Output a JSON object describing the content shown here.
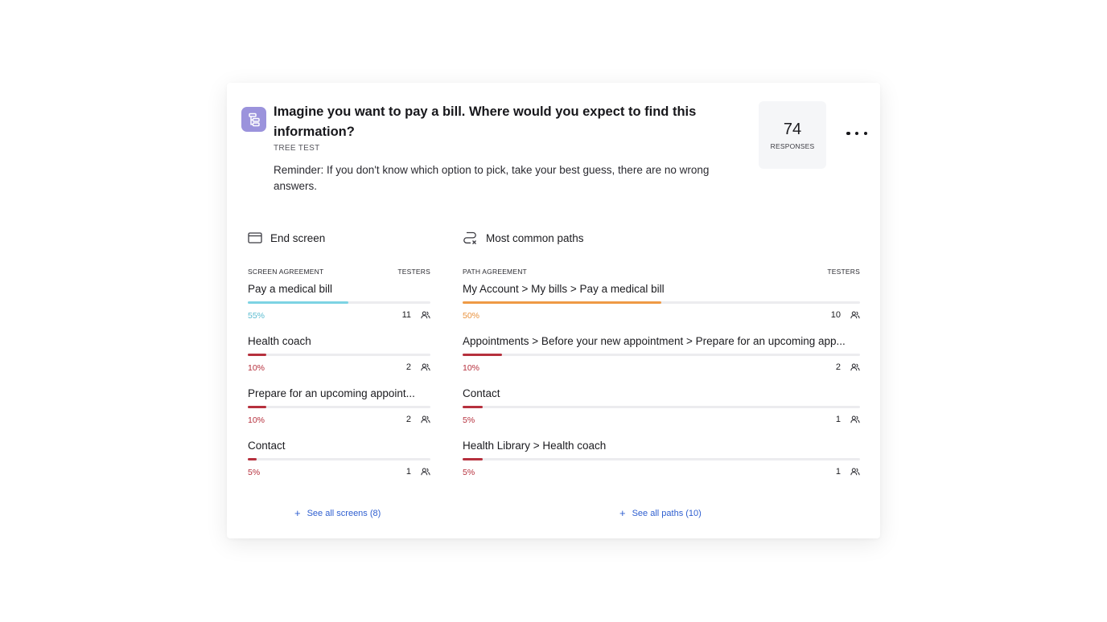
{
  "question": {
    "title": "Imagine you want to pay a bill. Where would you expect to find this information?",
    "type_label": "TREE TEST",
    "description": "Reminder: If you don't know which option to pick, take your best guess, there are no wrong answers.",
    "responses_count": "74",
    "responses_label": "RESPONSES",
    "icon": "tree-test-icon"
  },
  "end_screen": {
    "heading": "End screen",
    "col_left": "SCREEN AGREEMENT",
    "col_right": "TESTERS",
    "rows": [
      {
        "label": "Pay a medical bill",
        "percent_text": "55%",
        "fraction": 0.55,
        "count": "11",
        "color": "#7dd3e3",
        "pct_color": "#5bbcd0"
      },
      {
        "label": "Health coach",
        "percent_text": "10%",
        "fraction": 0.1,
        "count": "2",
        "color": "#b6303d",
        "pct_color": "#b6303d"
      },
      {
        "label": "Prepare for an upcoming appoint...",
        "percent_text": "10%",
        "fraction": 0.1,
        "count": "2",
        "color": "#b6303d",
        "pct_color": "#b6303d"
      },
      {
        "label": "Contact",
        "percent_text": "5%",
        "fraction": 0.05,
        "count": "1",
        "color": "#b6303d",
        "pct_color": "#b6303d"
      }
    ],
    "see_all": "See all screens (8)"
  },
  "common_paths": {
    "heading": "Most common paths",
    "col_left": "PATH AGREEMENT",
    "col_right": "TESTERS",
    "rows": [
      {
        "label": "My Account > My bills > Pay a medical bill",
        "percent_text": "50%",
        "fraction": 0.5,
        "count": "10",
        "color": "#ef9a45",
        "pct_color": "#e8913c"
      },
      {
        "label": "Appointments > Before your new appointment > Prepare for an upcoming app...",
        "percent_text": "10%",
        "fraction": 0.1,
        "count": "2",
        "color": "#b6303d",
        "pct_color": "#b6303d"
      },
      {
        "label": "Contact",
        "percent_text": "5%",
        "fraction": 0.05,
        "count": "1",
        "color": "#b6303d",
        "pct_color": "#b6303d"
      },
      {
        "label": "Health Library > Health coach",
        "percent_text": "5%",
        "fraction": 0.05,
        "count": "1",
        "color": "#b6303d",
        "pct_color": "#b6303d"
      }
    ],
    "see_all": "See all paths (10)"
  }
}
